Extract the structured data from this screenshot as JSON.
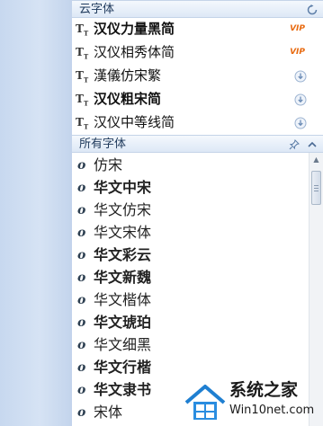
{
  "cloud_section": {
    "title": "云字体",
    "refresh_icon": "refresh-icon",
    "items": [
      {
        "name": "汉仪力量黑简",
        "weight": "900",
        "family": "\"DejaVu Sans\", sans-serif",
        "badge": "VIP"
      },
      {
        "name": "汉仪相秀体简",
        "weight": "400",
        "family": "\"DejaVu Serif\", serif",
        "badge": "VIP"
      },
      {
        "name": "漢儀仿宋繁",
        "weight": "400",
        "family": "\"DejaVu Serif\", serif",
        "badge": ""
      },
      {
        "name": "汉仪粗宋简",
        "weight": "700",
        "family": "\"DejaVu Serif\", serif",
        "badge": ""
      },
      {
        "name": "汉仪中等线简",
        "weight": "400",
        "family": "\"DejaVu Sans\", sans-serif",
        "badge": ""
      }
    ]
  },
  "all_section": {
    "title": "所有字体",
    "pin_icon": "pin-icon",
    "collapse_icon": "chevron-up-icon",
    "items": [
      {
        "name": "仿宋",
        "weight": "400",
        "family": "\"DejaVu Serif\", serif"
      },
      {
        "name": "华文中宋",
        "weight": "700",
        "family": "\"DejaVu Serif\", serif"
      },
      {
        "name": "华文仿宋",
        "weight": "400",
        "family": "\"DejaVu Serif\", serif"
      },
      {
        "name": "华文宋体",
        "weight": "400",
        "family": "\"DejaVu Serif\", serif"
      },
      {
        "name": "华文彩云",
        "weight": "700",
        "family": "\"DejaVu Sans\", sans-serif"
      },
      {
        "name": "华文新魏",
        "weight": "700",
        "family": "\"DejaVu Serif\", serif"
      },
      {
        "name": "华文楷体",
        "weight": "400",
        "family": "\"DejaVu Serif\", serif"
      },
      {
        "name": "华文琥珀",
        "weight": "900",
        "family": "\"DejaVu Sans\", sans-serif"
      },
      {
        "name": "华文细黑",
        "weight": "400",
        "family": "\"DejaVu Sans\", sans-serif"
      },
      {
        "name": "华文行楷",
        "weight": "700",
        "family": "\"DejaVu Serif\", serif"
      },
      {
        "name": "华文隶书",
        "weight": "700",
        "family": "\"DejaVu Serif\", serif"
      },
      {
        "name": "宋体",
        "weight": "400",
        "family": "\"DejaVu Serif\", serif"
      }
    ]
  },
  "watermark": {
    "line1": "系统之家",
    "line2": "Win10net.com",
    "logo_icon": "house-logo-icon"
  }
}
